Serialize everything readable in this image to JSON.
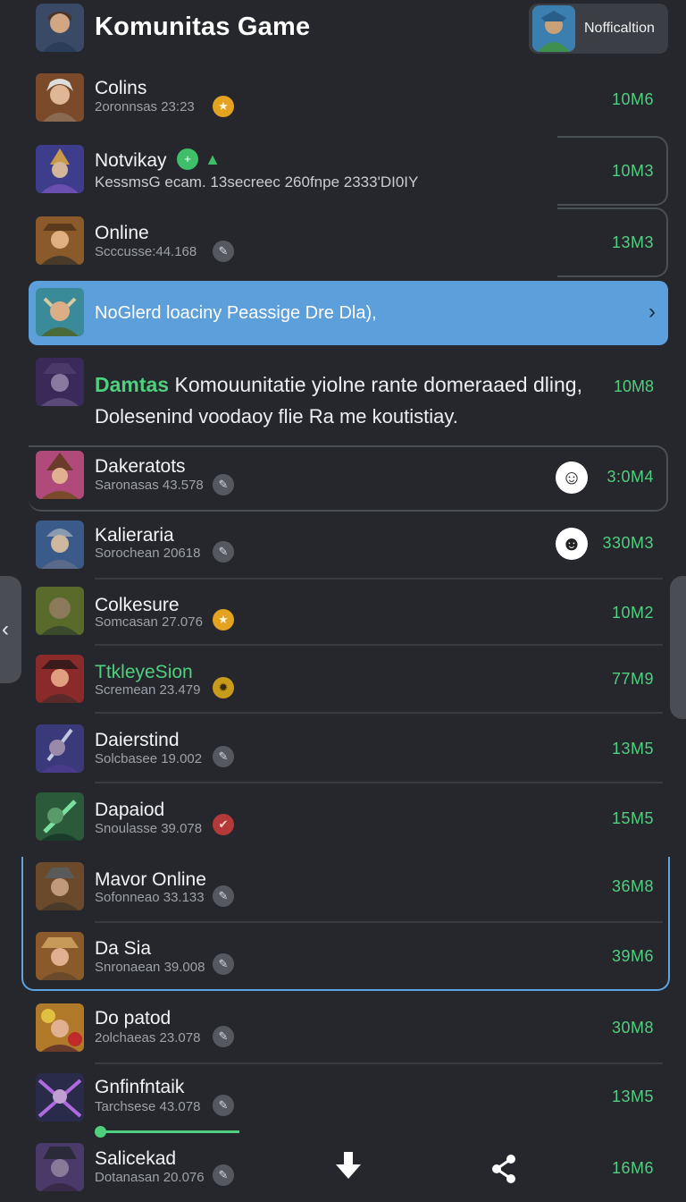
{
  "header": {
    "title": "Komunitas Game",
    "notification_label": "Nofficaltion"
  },
  "rows": [
    {
      "name": "Colins",
      "sub": "2oronnsas 23:23",
      "count": "10M6",
      "icon": "gold-star-icon"
    },
    {
      "name": "Notvikay",
      "sub": "KessmsG ecam. 13secreec 260fnpe 2333'DI0IY",
      "count": "10M3",
      "icon": "green-plus-lock-icon"
    },
    {
      "name": "Online",
      "sub": "Scccusse:44.168",
      "count": "13M3",
      "icon": "pen-icon"
    },
    {
      "name": "Dakeratots",
      "sub": "Saronasas 43.578",
      "count": "3:0M4",
      "icon": "pen-icon"
    },
    {
      "name": "Kalieraria",
      "sub": "Sorochean 20618",
      "count": "330M3",
      "icon": "pen-icon"
    },
    {
      "name": "Colkesure",
      "sub": "Somcasan 27.076",
      "count": "10M2",
      "icon": "gold-star-icon"
    },
    {
      "name": "TtkleyeSion",
      "sub": "Scremean 23.479",
      "count": "77M9",
      "icon": "gear-icon"
    },
    {
      "name": "Daierstind",
      "sub": "Solcbasee 19.002",
      "count": "13M5",
      "icon": "pen-icon"
    },
    {
      "name": "Dapaiod",
      "sub": "Snoulasse 39.078",
      "count": "15M5",
      "icon": "red-check-icon"
    },
    {
      "name": "Mavor Online",
      "sub": "Sofonneao 33.133",
      "count": "36M8",
      "icon": "pen-icon"
    },
    {
      "name": "Da Sia",
      "sub": "Snronaean 39.008",
      "count": "39M6",
      "icon": "pen-icon"
    },
    {
      "name": "Do patod",
      "sub": "2olchaeas 23.078",
      "count": "30M8",
      "icon": "pen-icon"
    },
    {
      "name": "Gnfinfntaik",
      "sub": "Tarchsese 43.078",
      "count": "13M5",
      "icon": "pen-icon"
    },
    {
      "name": "Salicekad",
      "sub": "Dotanasan 20.076",
      "count": "16M6",
      "icon": "pen-icon"
    }
  ],
  "banner": {
    "text": "NoGlerd loaciny Peassige Dre Dla),"
  },
  "message": {
    "author": "Damtas",
    "line1": "Komouunitatie yiolne rante domeraaed dling,",
    "line2": "Dolesenind voodaoy flie Ra me koutistiay.",
    "count": "10M8"
  },
  "colors": {
    "accent_green": "#4fd07e",
    "banner_blue": "#5d9fda",
    "background": "#25272c"
  }
}
